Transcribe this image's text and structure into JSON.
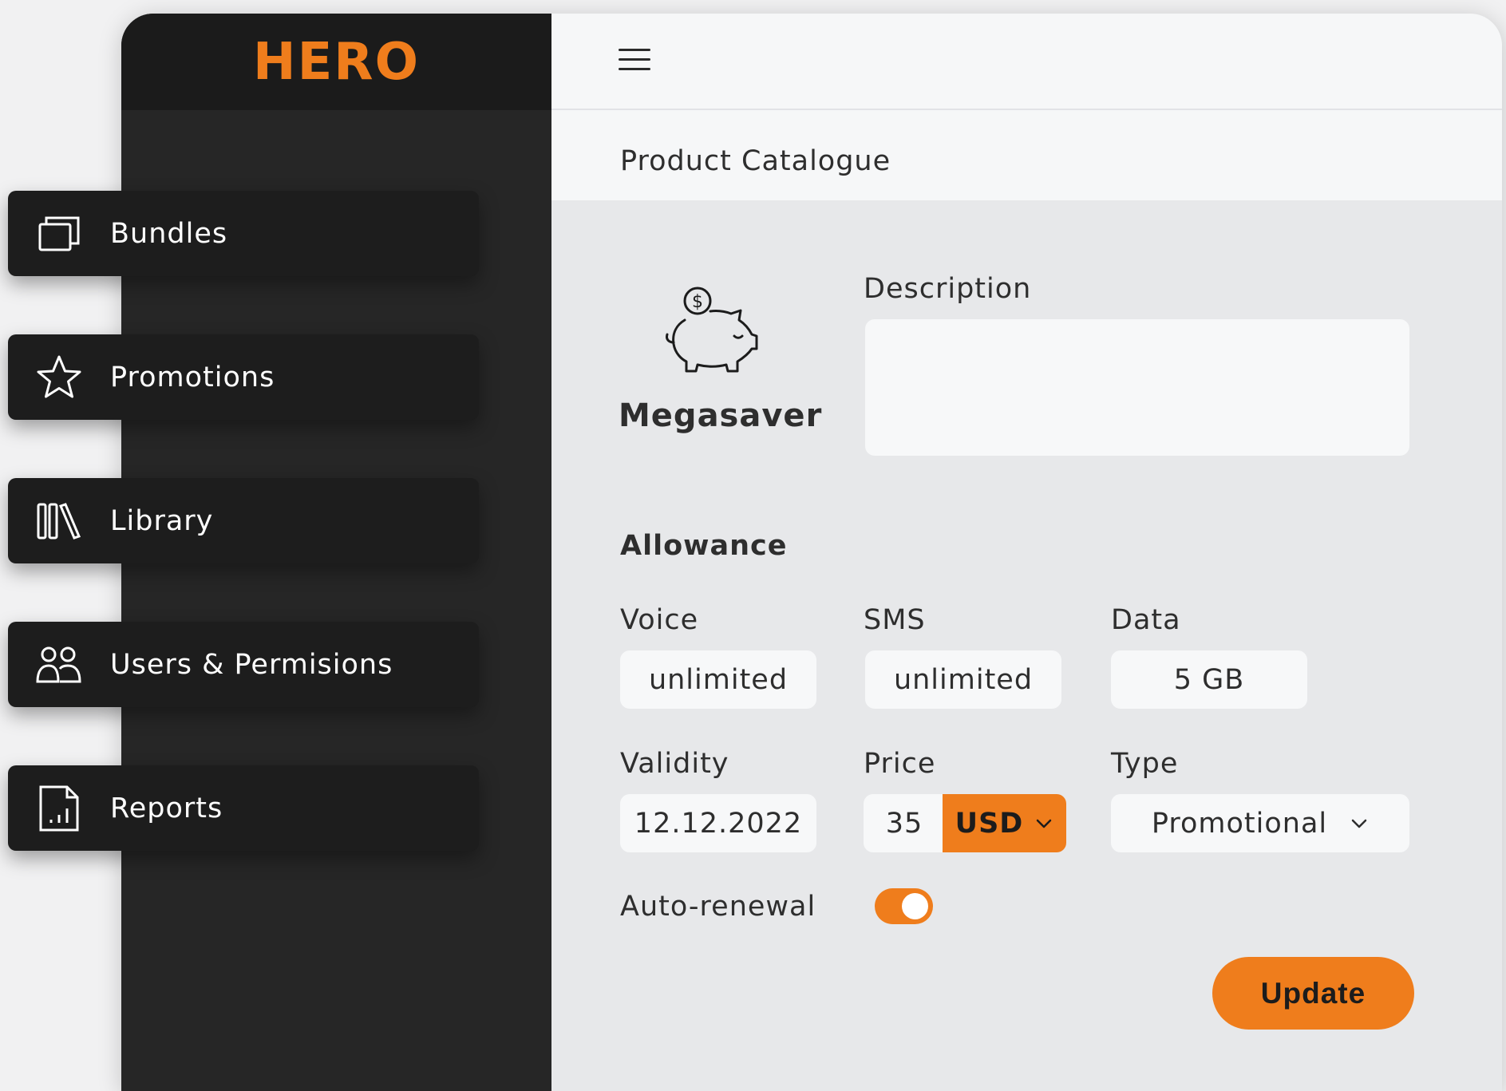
{
  "app": {
    "logo": "HERO"
  },
  "topbar": {
    "menu_icon": "hamburger-menu-icon"
  },
  "sidebar": {
    "items": [
      {
        "label": "Bundles",
        "icon": "bundles-icon"
      },
      {
        "label": "Promotions",
        "icon": "star-icon"
      },
      {
        "label": "Library",
        "icon": "library-icon"
      },
      {
        "label": "Users & Permisions",
        "icon": "users-icon"
      },
      {
        "label": "Reports",
        "icon": "report-icon"
      }
    ]
  },
  "page": {
    "title": "Product Catalogue"
  },
  "product": {
    "icon": "piggy-bank-icon",
    "name": "Megasaver",
    "description_label": "Description",
    "description_value": ""
  },
  "allowance": {
    "title": "Allowance",
    "voice": {
      "label": "Voice",
      "value": "unlimited"
    },
    "sms": {
      "label": "SMS",
      "value": "unlimited"
    },
    "data": {
      "label": "Data",
      "value": "5 GB"
    }
  },
  "details": {
    "validity": {
      "label": "Validity",
      "value": "12.12.2022"
    },
    "price": {
      "label": "Price",
      "value": "35",
      "currency": "USD"
    },
    "type": {
      "label": "Type",
      "value": "Promotional"
    }
  },
  "auto_renewal": {
    "label": "Auto-renewal",
    "enabled": true
  },
  "actions": {
    "update_label": "Update"
  },
  "colors": {
    "accent": "#ef7d1c",
    "sidebar": "#262626",
    "sidebar_header": "#1b1b1b",
    "content_bg": "#e7e8ea"
  }
}
